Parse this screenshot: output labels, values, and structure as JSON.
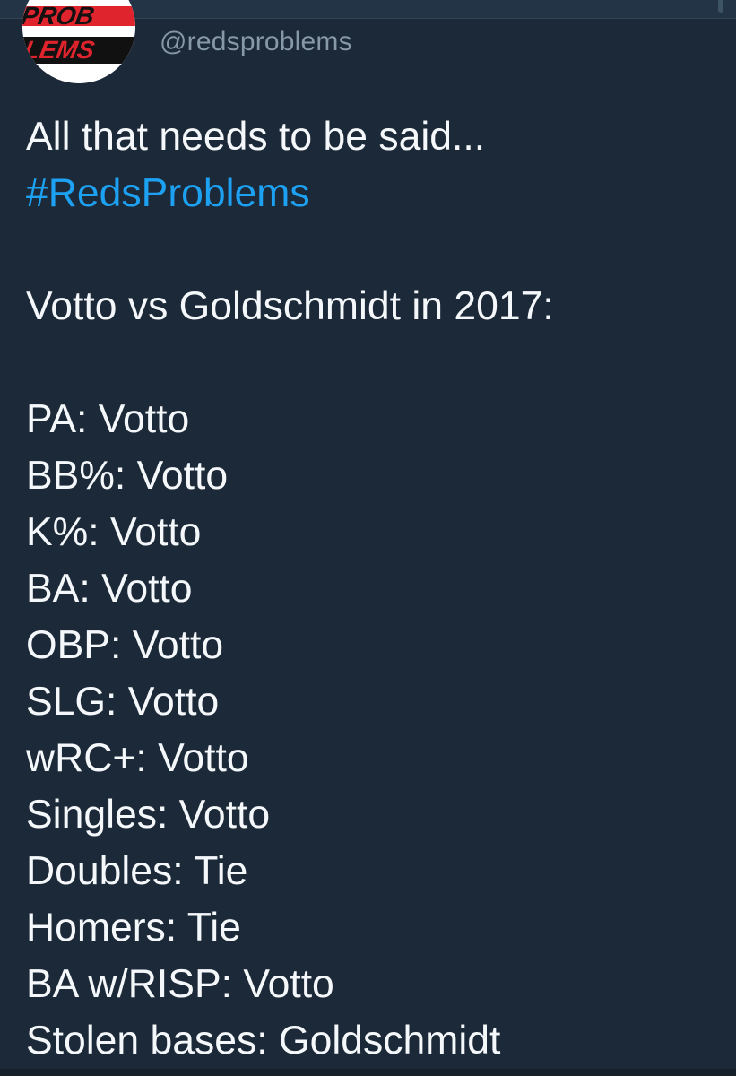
{
  "colors": {
    "background": "#1c2938",
    "text": "#f5f8fa",
    "handle": "#8899a6",
    "hashtag": "#1da1f2",
    "avatar_red": "#e0242e",
    "avatar_black": "#111111"
  },
  "tweet": {
    "avatar": {
      "logo_text_top": "PROB",
      "logo_text_bottom": "LEMS"
    },
    "handle": "@redsproblems",
    "text_line_1": "All that needs to be said...",
    "hashtag": "#RedsProblems",
    "heading": "Votto vs Goldschmidt in 2017:",
    "stats": [
      "PA: Votto",
      "BB%: Votto",
      "K%: Votto",
      "BA: Votto",
      "OBP: Votto",
      "SLG: Votto",
      "wRC+: Votto",
      "Singles: Votto",
      "Doubles: Tie",
      "Homers: Tie",
      "BA w/RISP: Votto",
      "Stolen bases: Goldschmidt"
    ]
  }
}
